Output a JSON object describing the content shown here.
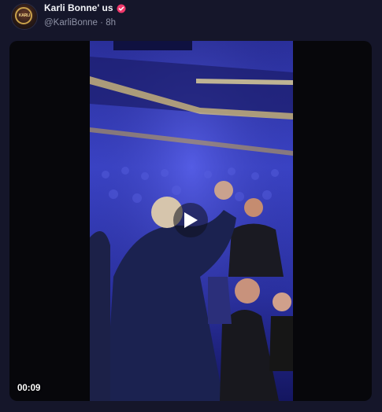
{
  "post": {
    "author_name": "Karli Bonne' us",
    "handle": "@KarliBonne",
    "separator": "·",
    "time_ago": "8h",
    "avatar_badge_text": "KARLI"
  },
  "video": {
    "duration": "00:09"
  },
  "colors": {
    "background": "#15162a",
    "verified_badge": "#f0386b",
    "handle_text": "#8e92a6"
  },
  "icons": {
    "verified": "verified-badge-icon",
    "play": "play-icon"
  }
}
